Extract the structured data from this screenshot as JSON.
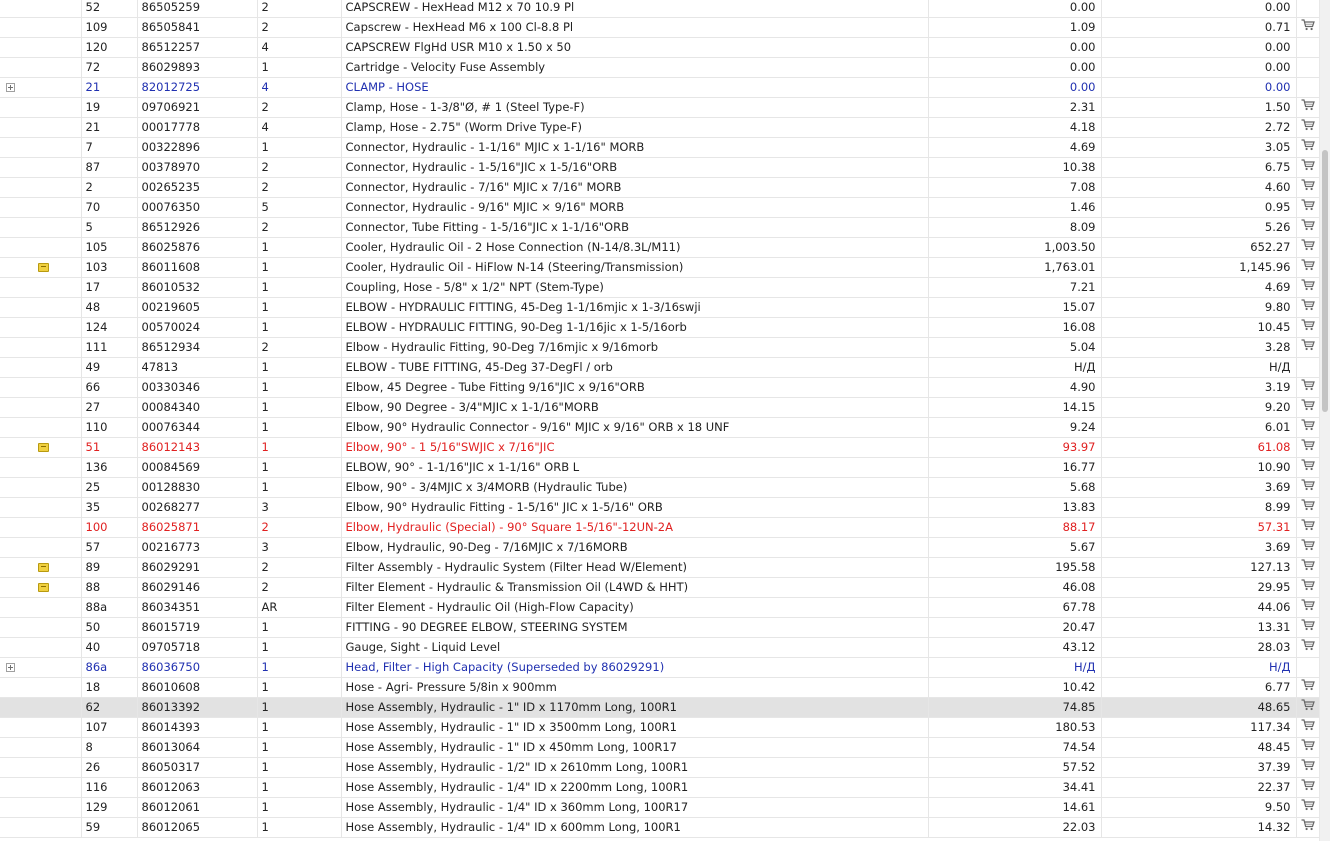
{
  "colors": {
    "blue_row": "#2030b0",
    "red_row": "#e02020",
    "selected_row": "#e2e2e2"
  },
  "icons": {
    "expand": "plus-box-icon",
    "note": "note-icon",
    "cart": "shopping-cart-icon"
  },
  "rows": [
    {
      "pos": "52",
      "part": "86505259",
      "qty": "2",
      "desc": "CAPSCREW - HexHead M12 x 70 10.9 Pl",
      "price1": "0.00",
      "price2": "0.00",
      "icon": "",
      "cart": false,
      "style": ""
    },
    {
      "pos": "109",
      "part": "86505841",
      "qty": "2",
      "desc": "Capscrew - HexHead M6 x 100 Cl-8.8 Pl",
      "price1": "1.09",
      "price2": "0.71",
      "icon": "",
      "cart": true,
      "style": ""
    },
    {
      "pos": "120",
      "part": "86512257",
      "qty": "4",
      "desc": "CAPSCREW FlgHd USR M10 x 1.50 x 50",
      "price1": "0.00",
      "price2": "0.00",
      "icon": "",
      "cart": false,
      "style": ""
    },
    {
      "pos": "72",
      "part": "86029893",
      "qty": "1",
      "desc": "Cartridge - Velocity Fuse Assembly",
      "price1": "0.00",
      "price2": "0.00",
      "icon": "",
      "cart": false,
      "style": ""
    },
    {
      "pos": "21",
      "part": "82012725",
      "qty": "4",
      "desc": "CLAMP - HOSE",
      "price1": "0.00",
      "price2": "0.00",
      "icon": "expand",
      "cart": false,
      "style": "blue"
    },
    {
      "pos": "19",
      "part": "09706921",
      "qty": "2",
      "desc": "Clamp, Hose - 1-3/8\"Ø, # 1 (Steel Type-F)",
      "price1": "2.31",
      "price2": "1.50",
      "icon": "",
      "cart": true,
      "style": ""
    },
    {
      "pos": "21",
      "part": "00017778",
      "qty": "4",
      "desc": "Clamp, Hose - 2.75\" (Worm Drive Type-F)",
      "price1": "4.18",
      "price2": "2.72",
      "icon": "",
      "cart": true,
      "style": ""
    },
    {
      "pos": "7",
      "part": "00322896",
      "qty": "1",
      "desc": "Connector, Hydraulic - 1-1/16\" MJIC x 1-1/16\" MORB",
      "price1": "4.69",
      "price2": "3.05",
      "icon": "",
      "cart": true,
      "style": ""
    },
    {
      "pos": "87",
      "part": "00378970",
      "qty": "2",
      "desc": "Connector, Hydraulic - 1-5/16\"JIC x 1-5/16\"ORB",
      "price1": "10.38",
      "price2": "6.75",
      "icon": "",
      "cart": true,
      "style": ""
    },
    {
      "pos": "2",
      "part": "00265235",
      "qty": "2",
      "desc": "Connector, Hydraulic - 7/16\" MJIC x 7/16\" MORB",
      "price1": "7.08",
      "price2": "4.60",
      "icon": "",
      "cart": true,
      "style": ""
    },
    {
      "pos": "70",
      "part": "00076350",
      "qty": "5",
      "desc": "Connector, Hydraulic - 9/16\" MJIC × 9/16\" MORB",
      "price1": "1.46",
      "price2": "0.95",
      "icon": "",
      "cart": true,
      "style": ""
    },
    {
      "pos": "5",
      "part": "86512926",
      "qty": "2",
      "desc": "Connector, Tube Fitting - 1-5/16\"JIC x 1-1/16\"ORB",
      "price1": "8.09",
      "price2": "5.26",
      "icon": "",
      "cart": true,
      "style": ""
    },
    {
      "pos": "105",
      "part": "86025876",
      "qty": "1",
      "desc": "Cooler, Hydraulic Oil - 2 Hose Connection (N-14/8.3L/M11)",
      "price1": "1,003.50",
      "price2": "652.27",
      "icon": "",
      "cart": true,
      "style": ""
    },
    {
      "pos": "103",
      "part": "86011608",
      "qty": "1",
      "desc": "Cooler, Hydraulic Oil - HiFlow N-14 (Steering/Transmission)",
      "price1": "1,763.01",
      "price2": "1,145.96",
      "icon": "note",
      "cart": true,
      "style": ""
    },
    {
      "pos": "17",
      "part": "86010532",
      "qty": "1",
      "desc": "Coupling, Hose - 5/8\" x 1/2\" NPT (Stem-Type)",
      "price1": "7.21",
      "price2": "4.69",
      "icon": "",
      "cart": true,
      "style": ""
    },
    {
      "pos": "48",
      "part": "00219605",
      "qty": "1",
      "desc": "ELBOW - HYDRAULIC FITTING, 45-Deg 1-1/16mjic x 1-3/16swji",
      "price1": "15.07",
      "price2": "9.80",
      "icon": "",
      "cart": true,
      "style": ""
    },
    {
      "pos": "124",
      "part": "00570024",
      "qty": "1",
      "desc": "ELBOW - HYDRAULIC FITTING, 90-Deg 1-1/16jic x 1-5/16orb",
      "price1": "16.08",
      "price2": "10.45",
      "icon": "",
      "cart": true,
      "style": ""
    },
    {
      "pos": "111",
      "part": "86512934",
      "qty": "2",
      "desc": "Elbow - Hydraulic Fitting, 90-Deg 7/16mjic x 9/16morb",
      "price1": "5.04",
      "price2": "3.28",
      "icon": "",
      "cart": true,
      "style": ""
    },
    {
      "pos": "49",
      "part": "47813",
      "qty": "1",
      "desc": "ELBOW - TUBE FITTING, 45-Deg 37-DegFl / orb",
      "price1": "Н/Д",
      "price2": "Н/Д",
      "icon": "",
      "cart": false,
      "style": ""
    },
    {
      "pos": "66",
      "part": "00330346",
      "qty": "1",
      "desc": "Elbow, 45 Degree - Tube Fitting 9/16\"JIC x 9/16\"ORB",
      "price1": "4.90",
      "price2": "3.19",
      "icon": "",
      "cart": true,
      "style": ""
    },
    {
      "pos": "27",
      "part": "00084340",
      "qty": "1",
      "desc": "Elbow, 90 Degree - 3/4\"MJIC x 1-1/16\"MORB",
      "price1": "14.15",
      "price2": "9.20",
      "icon": "",
      "cart": true,
      "style": ""
    },
    {
      "pos": "110",
      "part": "00076344",
      "qty": "1",
      "desc": "Elbow, 90° Hydraulic Connector - 9/16\" MJIC x 9/16\" ORB x 18 UNF",
      "price1": "9.24",
      "price2": "6.01",
      "icon": "",
      "cart": true,
      "style": ""
    },
    {
      "pos": "51",
      "part": "86012143",
      "qty": "1",
      "desc": "Elbow, 90° - 1 5/16\"SWJIC x 7/16\"JIC",
      "price1": "93.97",
      "price2": "61.08",
      "icon": "note",
      "cart": true,
      "style": "red"
    },
    {
      "pos": "136",
      "part": "00084569",
      "qty": "1",
      "desc": "ELBOW, 90° - 1-1/16\"JIC x 1-1/16\" ORB L",
      "price1": "16.77",
      "price2": "10.90",
      "icon": "",
      "cart": true,
      "style": ""
    },
    {
      "pos": "25",
      "part": "00128830",
      "qty": "1",
      "desc": "Elbow, 90° - 3/4MJIC x 3/4MORB (Hydraulic Tube)",
      "price1": "5.68",
      "price2": "3.69",
      "icon": "",
      "cart": true,
      "style": ""
    },
    {
      "pos": "35",
      "part": "00268277",
      "qty": "3",
      "desc": "Elbow, 90° Hydraulic Fitting - 1-5/16\" JIC x 1-5/16\" ORB",
      "price1": "13.83",
      "price2": "8.99",
      "icon": "",
      "cart": true,
      "style": ""
    },
    {
      "pos": "100",
      "part": "86025871",
      "qty": "2",
      "desc": "Elbow, Hydraulic (Special) - 90° Square 1-5/16\"-12UN-2A",
      "price1": "88.17",
      "price2": "57.31",
      "icon": "",
      "cart": true,
      "style": "red"
    },
    {
      "pos": "57",
      "part": "00216773",
      "qty": "3",
      "desc": "Elbow, Hydraulic, 90-Deg - 7/16MJIC x 7/16MORB",
      "price1": "5.67",
      "price2": "3.69",
      "icon": "",
      "cart": true,
      "style": ""
    },
    {
      "pos": "89",
      "part": "86029291",
      "qty": "2",
      "desc": "Filter Assembly - Hydraulic System (Filter Head W/Element)",
      "price1": "195.58",
      "price2": "127.13",
      "icon": "note",
      "cart": true,
      "style": ""
    },
    {
      "pos": "88",
      "part": "86029146",
      "qty": "2",
      "desc": "Filter Element - Hydraulic & Transmission Oil (L4WD & HHT)",
      "price1": "46.08",
      "price2": "29.95",
      "icon": "note",
      "cart": true,
      "style": ""
    },
    {
      "pos": "88a",
      "part": "86034351",
      "qty": "AR",
      "desc": "Filter Element - Hydraulic Oil (High-Flow Capacity)",
      "price1": "67.78",
      "price2": "44.06",
      "icon": "",
      "cart": true,
      "style": ""
    },
    {
      "pos": "50",
      "part": "86015719",
      "qty": "1",
      "desc": "FITTING - 90 DEGREE ELBOW, STEERING SYSTEM",
      "price1": "20.47",
      "price2": "13.31",
      "icon": "",
      "cart": true,
      "style": ""
    },
    {
      "pos": "40",
      "part": "09705718",
      "qty": "1",
      "desc": "Gauge, Sight - Liquid Level",
      "price1": "43.12",
      "price2": "28.03",
      "icon": "",
      "cart": true,
      "style": ""
    },
    {
      "pos": "86a",
      "part": "86036750",
      "qty": "1",
      "desc": "Head, Filter - High Capacity (Superseded by 86029291)",
      "price1": "Н/Д",
      "price2": "Н/Д",
      "icon": "expand",
      "cart": false,
      "style": "blue"
    },
    {
      "pos": "18",
      "part": "86010608",
      "qty": "1",
      "desc": "Hose - Agri- Pressure 5/8in x 900mm",
      "price1": "10.42",
      "price2": "6.77",
      "icon": "",
      "cart": true,
      "style": ""
    },
    {
      "pos": "62",
      "part": "86013392",
      "qty": "1",
      "desc": "Hose Assembly, Hydraulic - 1\" ID x 1170mm Long, 100R1",
      "price1": "74.85",
      "price2": "48.65",
      "icon": "",
      "cart": true,
      "style": "selected"
    },
    {
      "pos": "107",
      "part": "86014393",
      "qty": "1",
      "desc": "Hose Assembly, Hydraulic - 1\" ID x 3500mm Long, 100R1",
      "price1": "180.53",
      "price2": "117.34",
      "icon": "",
      "cart": true,
      "style": ""
    },
    {
      "pos": "8",
      "part": "86013064",
      "qty": "1",
      "desc": "Hose Assembly, Hydraulic - 1\" ID x 450mm Long, 100R17",
      "price1": "74.54",
      "price2": "48.45",
      "icon": "",
      "cart": true,
      "style": ""
    },
    {
      "pos": "26",
      "part": "86050317",
      "qty": "1",
      "desc": "Hose Assembly, Hydraulic - 1/2\" ID x 2610mm Long, 100R1",
      "price1": "57.52",
      "price2": "37.39",
      "icon": "",
      "cart": true,
      "style": ""
    },
    {
      "pos": "116",
      "part": "86012063",
      "qty": "1",
      "desc": "Hose Assembly, Hydraulic - 1/4\" ID x 2200mm Long, 100R1",
      "price1": "34.41",
      "price2": "22.37",
      "icon": "",
      "cart": true,
      "style": ""
    },
    {
      "pos": "129",
      "part": "86012061",
      "qty": "1",
      "desc": "Hose Assembly, Hydraulic - 1/4\" ID x 360mm Long, 100R17",
      "price1": "14.61",
      "price2": "9.50",
      "icon": "",
      "cart": true,
      "style": ""
    },
    {
      "pos": "59",
      "part": "86012065",
      "qty": "1",
      "desc": "Hose Assembly, Hydraulic - 1/4\" ID x 600mm Long, 100R1",
      "price1": "22.03",
      "price2": "14.32",
      "icon": "",
      "cart": true,
      "style": ""
    }
  ]
}
